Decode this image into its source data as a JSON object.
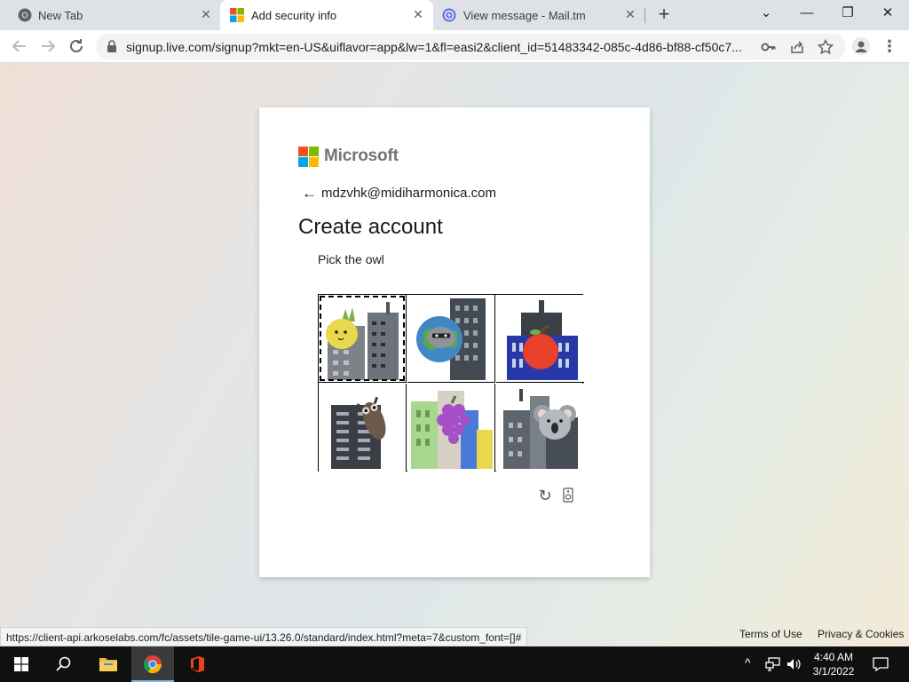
{
  "browser": {
    "tabs": [
      {
        "title": "New Tab",
        "favicon": "chrome-icon"
      },
      {
        "title": "Add security info",
        "favicon": "microsoft-icon",
        "active": true
      },
      {
        "title": "View message - Mail.tm",
        "favicon": "mail-tm-icon"
      }
    ],
    "close_glyph": "✕",
    "new_tab_glyph": "+",
    "window_controls": {
      "minimize": "—",
      "restore": "❐",
      "close": "✕",
      "tab_search": "⌄"
    },
    "url": "signup.live.com/signup?mkt=en-US&uiflavor=app&lw=1&fl=easi2&client_id=51483342-085c-4d86-bf88-cf50c7...",
    "status_url": "https://client-api.arkoselabs.com/fc/assets/tile-game-ui/13.26.0/standard/index.html?meta=7&custom_font=[]#"
  },
  "signup": {
    "brand": "Microsoft",
    "back_glyph": "←",
    "email": "mdzvhk@midiharmonica.com",
    "heading": "Create account",
    "prompt": "Pick the owl",
    "tiles": [
      {
        "name": "pineapple",
        "selected": true
      },
      {
        "name": "raccoon"
      },
      {
        "name": "apple"
      },
      {
        "name": "owl"
      },
      {
        "name": "grapes"
      },
      {
        "name": "koala"
      }
    ],
    "reload_glyph": "↻"
  },
  "footer": {
    "terms": "Terms of Use",
    "privacy": "Privacy & Cookies"
  },
  "taskbar": {
    "apps": [
      "windows-start",
      "search",
      "file-explorer",
      "chrome",
      "office"
    ],
    "time": "4:40 AM",
    "date": "3/1/2022"
  },
  "colors": {
    "ms_red": "#f25022",
    "ms_green": "#7fba00",
    "ms_blue": "#00a4ef",
    "ms_yellow": "#ffb900"
  }
}
